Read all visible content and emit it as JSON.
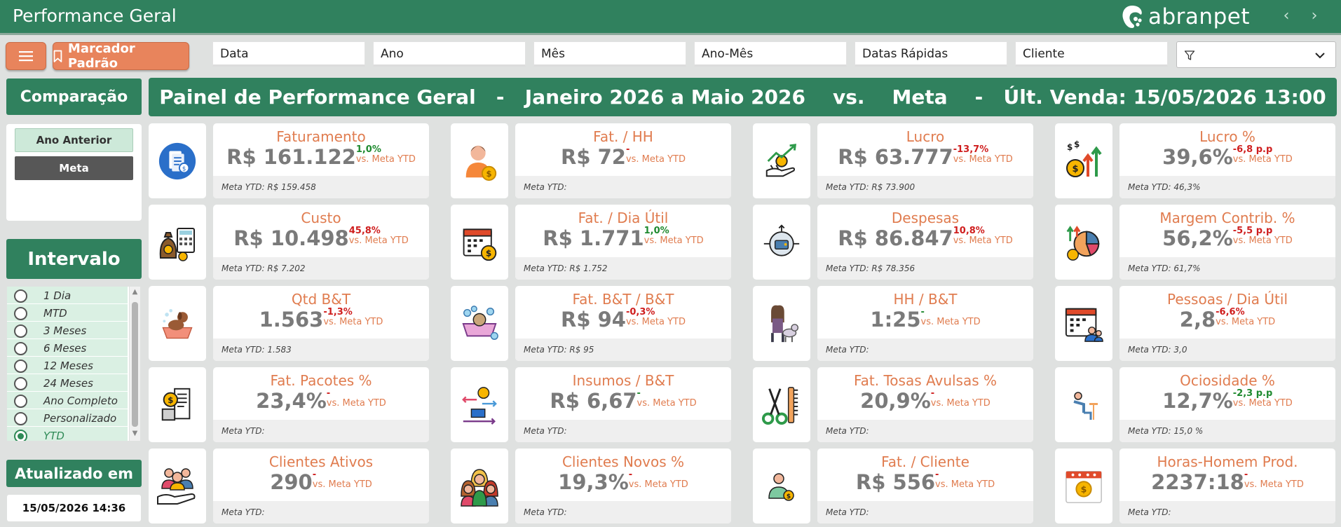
{
  "header": {
    "title": "Performance Geral",
    "brand": "abranpet",
    "prev_icon": "chevron-left-icon",
    "next_icon": "chevron-right-icon"
  },
  "toolbar": {
    "menu_icon": "hamburger-icon",
    "bookmark_label": "Marcador Padrão"
  },
  "slicers": [
    {
      "label": "Data"
    },
    {
      "label": "Ano"
    },
    {
      "label": "Mês"
    },
    {
      "label": "Ano-Mês"
    },
    {
      "label": "Datas Rápidas"
    },
    {
      "label": "Cliente"
    }
  ],
  "filter": {
    "icon": "filter-icon",
    "value": ""
  },
  "comparacao": {
    "title": "Comparação",
    "options": [
      {
        "label": "Ano Anterior"
      },
      {
        "label": "Meta"
      }
    ],
    "selected": "Meta"
  },
  "intervalo": {
    "title": "Intervalo",
    "items": [
      {
        "label": "1 Dia"
      },
      {
        "label": "MTD"
      },
      {
        "label": "3 Meses"
      },
      {
        "label": "6 Meses"
      },
      {
        "label": "12 Meses"
      },
      {
        "label": "24 Meses"
      },
      {
        "label": "Ano Completo"
      },
      {
        "label": "Personalizado"
      },
      {
        "label": "YTD"
      }
    ],
    "selected": "YTD"
  },
  "atualizado": {
    "title": "Atualizado em",
    "value": "15/05/2026 14:36"
  },
  "main": {
    "title": "Painel de Performance Geral   -   Janeiro 2026 a Maio 2026    vs.    Meta    -   Últ. Venda: 15/05/2026 13:00"
  },
  "colors": {
    "primary_green": "#30815e",
    "accent_orange": "#e07c4f",
    "negative": "#cf1e1e",
    "positive": "#1f8a2f"
  },
  "kpis": [
    {
      "title": "Faturamento",
      "value": "R$ 161.122",
      "delta": "1,0%",
      "delta_type": "pos",
      "vs": "vs. Meta YTD",
      "footer": "Meta YTD: R$ 159.458",
      "icon": "invoice-icon"
    },
    {
      "title": "Fat. / HH",
      "value": "R$ 72",
      "delta": "-",
      "delta_type": "neg",
      "vs": "vs. Meta YTD",
      "footer": "Meta YTD:",
      "icon": "person-coin-icon"
    },
    {
      "title": "Lucro",
      "value": "R$ 63.777",
      "delta": "-13,7%",
      "delta_type": "neg",
      "vs": "vs. Meta YTD",
      "footer": "Meta YTD: R$ 73.900",
      "icon": "profit-growth-icon"
    },
    {
      "title": "Lucro %",
      "value": "39,6%",
      "delta": "-6,8 p.p",
      "delta_type": "neg",
      "vs": "vs. Meta YTD",
      "footer": "Meta YTD: 46,3%",
      "icon": "coins-arrows-icon"
    },
    {
      "title": "Custo",
      "value": "R$ 10.498",
      "delta": "45,8%",
      "delta_type": "neg",
      "vs": "vs. Meta YTD",
      "footer": "Meta YTD: R$ 7.202",
      "icon": "money-bag-calculator-icon"
    },
    {
      "title": "Fat. / Dia Útil",
      "value": "R$ 1.771",
      "delta": "1,0%",
      "delta_type": "pos",
      "vs": "vs. Meta YTD",
      "footer": "Meta YTD: R$ 1.752",
      "icon": "calendar-coin-icon"
    },
    {
      "title": "Despesas",
      "value": "R$ 86.847",
      "delta": "10,8%",
      "delta_type": "neg",
      "vs": "vs. Meta YTD",
      "footer": "Meta YTD: R$ 78.356",
      "icon": "wallet-arrows-icon"
    },
    {
      "title": "Margem Contrib. %",
      "value": "56,2%",
      "delta": "-5,5 p.p",
      "delta_type": "neg",
      "vs": "vs. Meta YTD",
      "footer": "Meta YTD: 61,7%",
      "icon": "pie-chart-coin-icon"
    },
    {
      "title": "Qtd B&T",
      "value": "1.563",
      "delta": "-1,3%",
      "delta_type": "neg",
      "vs": "vs. Meta YTD",
      "footer": "Meta YTD: 1.583",
      "icon": "dog-bath-icon"
    },
    {
      "title": "Fat. B&T / B&T",
      "value": "R$ 94",
      "delta": "-0,3%",
      "delta_type": "neg",
      "vs": "vs. Meta YTD",
      "footer": "Meta YTD: R$ 95",
      "icon": "pet-bathtub-icon"
    },
    {
      "title": "HH / B&T",
      "value": "1:25",
      "delta": "-",
      "delta_type": "pos",
      "vs": "vs. Meta YTD",
      "footer": "Meta YTD:",
      "icon": "groomer-dog-icon"
    },
    {
      "title": "Pessoas / Dia Útil",
      "value": "2,8",
      "delta": "-6,6%",
      "delta_type": "neg",
      "vs": "vs. Meta YTD",
      "footer": "Meta YTD: 3,0",
      "icon": "calendar-people-icon"
    },
    {
      "title": "Fat. Pacotes %",
      "value": "23,4%",
      "delta": "-",
      "delta_type": "neg",
      "vs": "vs. Meta YTD",
      "footer": "Meta YTD:",
      "icon": "receipt-coin-icon"
    },
    {
      "title": "Insumos / B&T",
      "value": "R$ 6,67",
      "delta": "-",
      "delta_type": "pos",
      "vs": "vs. Meta YTD",
      "footer": "Meta YTD:",
      "icon": "supplies-flow-icon"
    },
    {
      "title": "Fat. Tosas Avulsas %",
      "value": "20,9%",
      "delta": "-",
      "delta_type": "neg",
      "vs": "vs. Meta YTD",
      "footer": "Meta YTD:",
      "icon": "scissors-comb-icon"
    },
    {
      "title": "Ociosidade %",
      "value": "12,7%",
      "delta": "-2,3 p.p",
      "delta_type": "pos",
      "vs": "vs. Meta YTD",
      "footer": "Meta YTD: 15,0 %",
      "icon": "idle-person-icon"
    },
    {
      "title": "Clientes Ativos",
      "value": "290",
      "delta": "-",
      "delta_type": "neg",
      "vs": "vs. Meta YTD",
      "footer": "Meta YTD:",
      "icon": "hand-people-icon"
    },
    {
      "title": "Clientes Novos %",
      "value": "19,3%",
      "delta": "-",
      "delta_type": "neg",
      "vs": "vs. Meta YTD",
      "footer": "Meta YTD:",
      "icon": "group-women-icon"
    },
    {
      "title": "Fat. / Cliente",
      "value": "R$ 556",
      "delta": "-",
      "delta_type": "neg",
      "vs": "vs. Meta YTD",
      "footer": "Meta YTD:",
      "icon": "client-coin-icon"
    },
    {
      "title": "Horas-Homem Prod.",
      "value": "2237:18",
      "delta": "-",
      "delta_type": "neg",
      "vs": "vs. Meta YTD",
      "footer": "Meta YTD:",
      "icon": "calendar-money-icon"
    }
  ]
}
